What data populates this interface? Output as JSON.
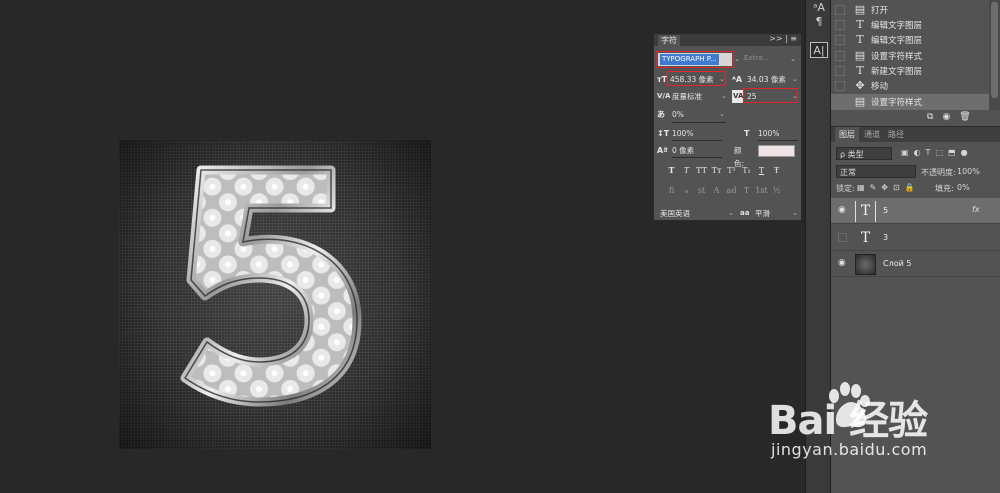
{
  "canvas": {
    "glyph": "5"
  },
  "history": {
    "items": [
      {
        "icon": "document-icon",
        "label": "打开"
      },
      {
        "icon": "type-icon",
        "label": "编辑文字图层"
      },
      {
        "icon": "type-icon",
        "label": "编辑文字图层"
      },
      {
        "icon": "document-icon",
        "label": "设置字符样式"
      },
      {
        "icon": "type-icon",
        "label": "新建文字图层"
      },
      {
        "icon": "move-icon",
        "label": "移动"
      },
      {
        "icon": "document-icon",
        "label": "设置字符样式",
        "selected": true
      }
    ]
  },
  "layers_panel": {
    "tabs": [
      "图层",
      "通道",
      "路径"
    ],
    "filter_label": "ρ 类型",
    "blend_mode": "正常",
    "opacity_label": "不透明度:",
    "opacity_value": "100%",
    "lock_label": "锁定:",
    "fill_label": "填充:",
    "fill_value": "0%",
    "layers": [
      {
        "name": "5",
        "kind": "text",
        "visible": true,
        "selected": true,
        "fx": "fx"
      },
      {
        "name": "3",
        "kind": "text",
        "visible": false
      },
      {
        "name": "Слой 5",
        "kind": "image",
        "visible": true
      }
    ]
  },
  "character_panel": {
    "title": "字符",
    "controls": ">> | ≡",
    "font_family": "TYPOGRAPH P...",
    "font_style": "Extra...",
    "font_size": "458.33 像素",
    "leading": "34.03 像素",
    "kerning": "度量标准",
    "tracking": "25",
    "scale_pct": "0%",
    "vertical_scale": "100%",
    "horizontal_scale": "100%",
    "baseline_shift": "0 像素",
    "color_label": "颜色:",
    "color_value": "#f0e4e4",
    "style_buttons": [
      "T",
      "T",
      "TT",
      "Tт",
      "T¹",
      "T₁",
      "T",
      "Ŧ"
    ],
    "opentype_buttons": [
      "fi",
      "ℴ",
      "st",
      "A",
      "ad",
      "T",
      "1st",
      "½"
    ],
    "language": "美国英语",
    "antialias": "平滑"
  },
  "watermark": {
    "logo_text": "Bai 经验",
    "url": "jingyan.baidu.com"
  }
}
